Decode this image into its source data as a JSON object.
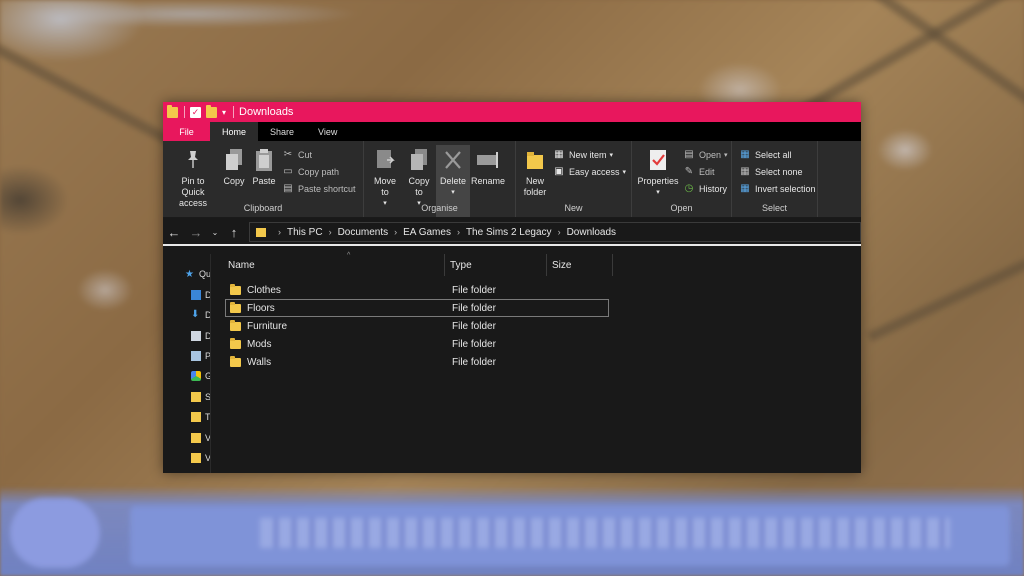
{
  "window": {
    "title": "Downloads",
    "accent": "#e8175d"
  },
  "tabs": {
    "file": "File",
    "home": "Home",
    "share": "Share",
    "view": "View"
  },
  "ribbon": {
    "clipboard": {
      "label": "Clipboard",
      "pin": "Pin to Quick access",
      "copy": "Copy",
      "paste": "Paste",
      "cut": "Cut",
      "copy_path": "Copy path",
      "paste_shortcut": "Paste shortcut"
    },
    "organise": {
      "label": "Organise",
      "move_to": "Move to",
      "copy_to": "Copy to",
      "delete": "Delete",
      "rename": "Rename"
    },
    "new": {
      "label": "New",
      "new_folder": "New folder",
      "new_item": "New item",
      "easy_access": "Easy access"
    },
    "open": {
      "label": "Open",
      "properties": "Properties",
      "open": "Open",
      "edit": "Edit",
      "history": "History"
    },
    "select": {
      "label": "Select",
      "select_all": "Select all",
      "select_none": "Select none",
      "invert_selection": "Invert selection"
    }
  },
  "address": {
    "crumbs": [
      "This PC",
      "Documents",
      "EA Games",
      "The Sims 2 Legacy",
      "Downloads"
    ]
  },
  "nav_pane": {
    "items": [
      "Qu",
      "D",
      "D",
      "D",
      "P",
      "G",
      "S",
      "T",
      "V",
      "V"
    ]
  },
  "columns": {
    "name": "Name",
    "type": "Type",
    "size": "Size"
  },
  "files": [
    {
      "name": "Clothes",
      "type": "File folder"
    },
    {
      "name": "Floors",
      "type": "File folder"
    },
    {
      "name": "Furniture",
      "type": "File folder"
    },
    {
      "name": "Mods",
      "type": "File folder"
    },
    {
      "name": "Walls",
      "type": "File folder"
    }
  ]
}
